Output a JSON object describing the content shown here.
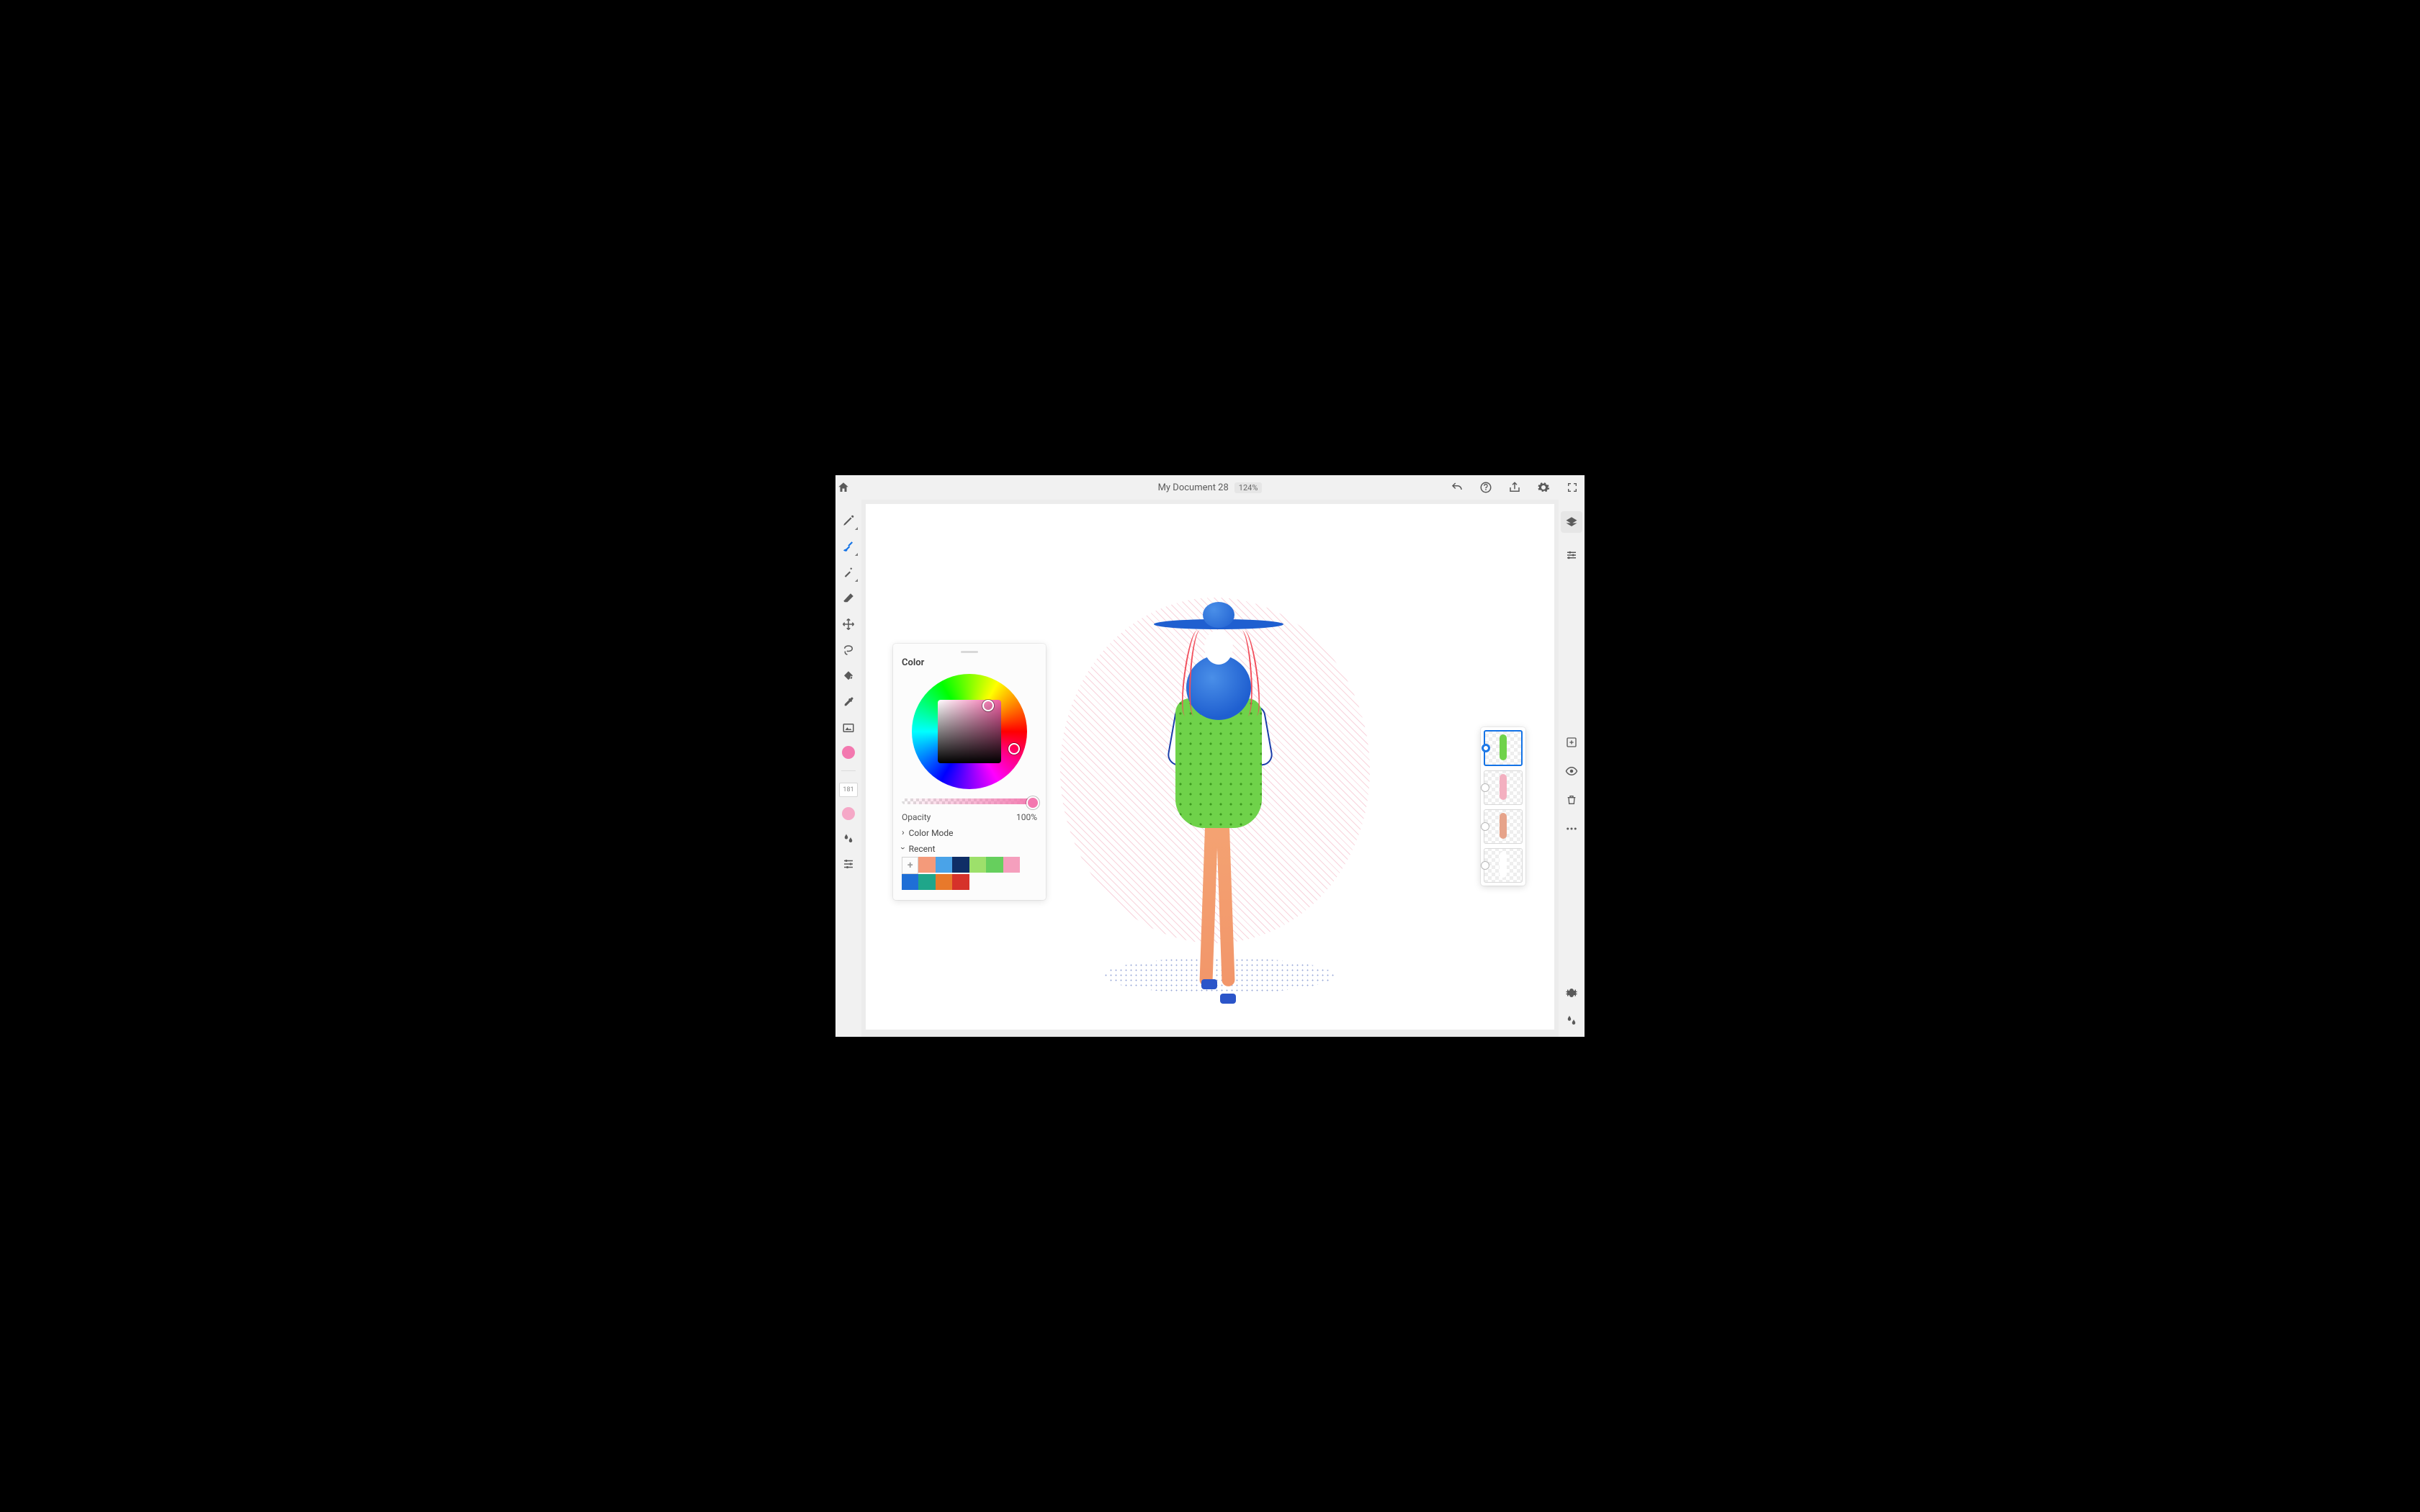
{
  "document": {
    "title": "My Document 28",
    "zoom": "124%"
  },
  "topbar_icons": {
    "home": "home-icon",
    "undo": "undo-icon",
    "help": "help-icon",
    "share": "share-icon",
    "settings": "gear-icon",
    "fullscreen": "fullscreen-icon"
  },
  "left_tools": {
    "brush_size_value": "181",
    "current_color": "#f378af",
    "secondary_color": "#f5a8c7"
  },
  "color_panel": {
    "title": "Color",
    "opacity_label": "Opacity",
    "opacity_value": "100%",
    "color_mode_label": "Color Mode",
    "recent_label": "Recent",
    "recent_colors": [
      "#f49a7a",
      "#4aa3e8",
      "#0f2e66",
      "#9de06b",
      "#66cf5d",
      "#f59fbd",
      "#1f6fd6",
      "#1fa68a",
      "#e8792b",
      "#d6322a"
    ]
  },
  "right_tools": {
    "layers": "layers-icon",
    "properties": "sliders-icon",
    "add_layer": "add-icon",
    "visibility": "eye-icon",
    "delete": "trash-icon",
    "more": "ellipsis-icon",
    "bug": "bug-icon",
    "water": "water-drops-icon"
  },
  "layers": [
    {
      "selected": true,
      "tint": "#6fd24a"
    },
    {
      "selected": false,
      "tint": "#f3b0c0"
    },
    {
      "selected": false,
      "tint": "#e6a38a"
    },
    {
      "selected": false,
      "tint": "#ffffff"
    }
  ]
}
